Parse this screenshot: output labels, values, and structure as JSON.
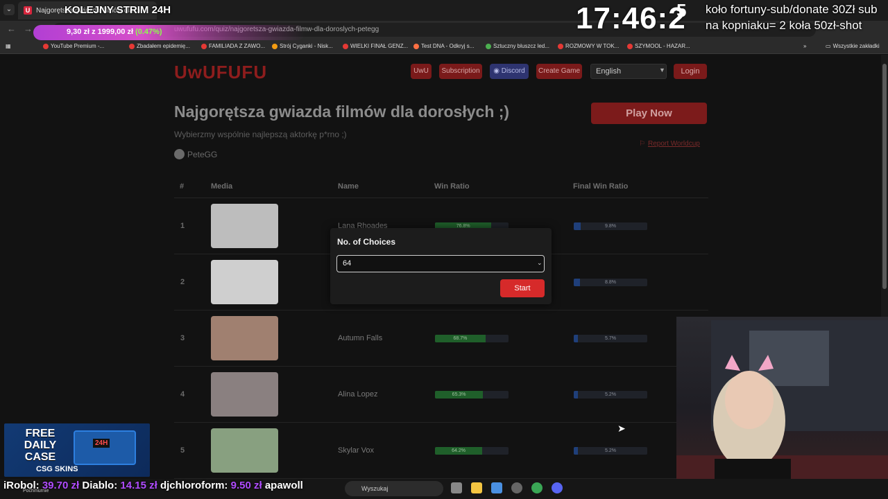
{
  "browser": {
    "tab_title": "Najgorętsza gwiazda filmów dla dorosłych ;)",
    "tab_favicon": "U",
    "url": "uwufufu.com/quiz/najgoretsza-gwiazda-filmw-dla-doroslych-petegg",
    "bookmarks": [
      "YouTube Premium -...",
      "Zbadałem epidemię...",
      "FAMILIADA Z ZAWO...",
      "Strój Cyganki - Nisk...",
      "WIELKI FINAŁ GENZ...",
      "Test DNA - Odkryj s...",
      "Sztuczny bluszcz led...",
      "ROZMOWY W TOK...",
      "SZYMOOL - HAZAR...",
      "Wszystkie zakładki"
    ]
  },
  "overlay": {
    "stream_title": "KOLEJNY STRIM 24H",
    "donation_text": "9,30 zł z 1999,00 zł",
    "donation_pct": "(0.47%)",
    "clock": "17:46:2",
    "clock_extra": "5",
    "wheel_text": "koło fortuny-sub/donate 30Zł sub na kopniaku= 2 koła 50zł-shot",
    "ticker": [
      {
        "name": "iRobol:",
        "amount": "39.70 zł"
      },
      {
        "name": "Diablo:",
        "amount": "14.15 zł"
      },
      {
        "name": "djchloroform:",
        "amount": "9.50 zł"
      },
      {
        "name": "apawoll",
        "amount": ""
      }
    ],
    "promo": {
      "line1": "FREE",
      "line2": "DAILY",
      "line3": "CASE",
      "badge": "24H",
      "brand": "CSG SKINS"
    }
  },
  "site": {
    "logo": "UwUFUFU",
    "nav": [
      "UwU",
      "Subscription",
      "Discord",
      "Create Game"
    ],
    "language": "English",
    "login": "Login",
    "title": "Najgorętsza gwiazda filmów dla dorosłych ;)",
    "play_now": "Play Now",
    "subtitle": "Wybierzmy wspólnie najlepszą aktorkę p*rno ;)",
    "report": "Report Worldcup",
    "author": "PeteGG",
    "table_headers": [
      "#",
      "Media",
      "Name",
      "Win Ratio",
      "Final Win Ratio"
    ],
    "rows": [
      {
        "rank": "1",
        "name": "Lana Rhoades",
        "win": 76.8,
        "win_label": "76.8%",
        "final": 9.8,
        "final_label": "9.8%"
      },
      {
        "rank": "2",
        "name": "",
        "win": 0,
        "win_label": "",
        "final": 8.8,
        "final_label": "8.8%"
      },
      {
        "rank": "3",
        "name": "Autumn Falls",
        "win": 68.7,
        "win_label": "68.7%",
        "final": 5.7,
        "final_label": "5.7%"
      },
      {
        "rank": "4",
        "name": "Alina Lopez",
        "win": 65.3,
        "win_label": "65.3%",
        "final": 5.2,
        "final_label": "5.2%"
      },
      {
        "rank": "5",
        "name": "Skylar Vox",
        "win": 64.2,
        "win_label": "64.2%",
        "final": 5.2,
        "final_label": "5.2%"
      }
    ]
  },
  "modal": {
    "title": "No. of Choices",
    "selected": "64",
    "start": "Start"
  },
  "taskbar": {
    "search_placeholder": "Wyszukaj",
    "weather": "Pochmurnie"
  }
}
